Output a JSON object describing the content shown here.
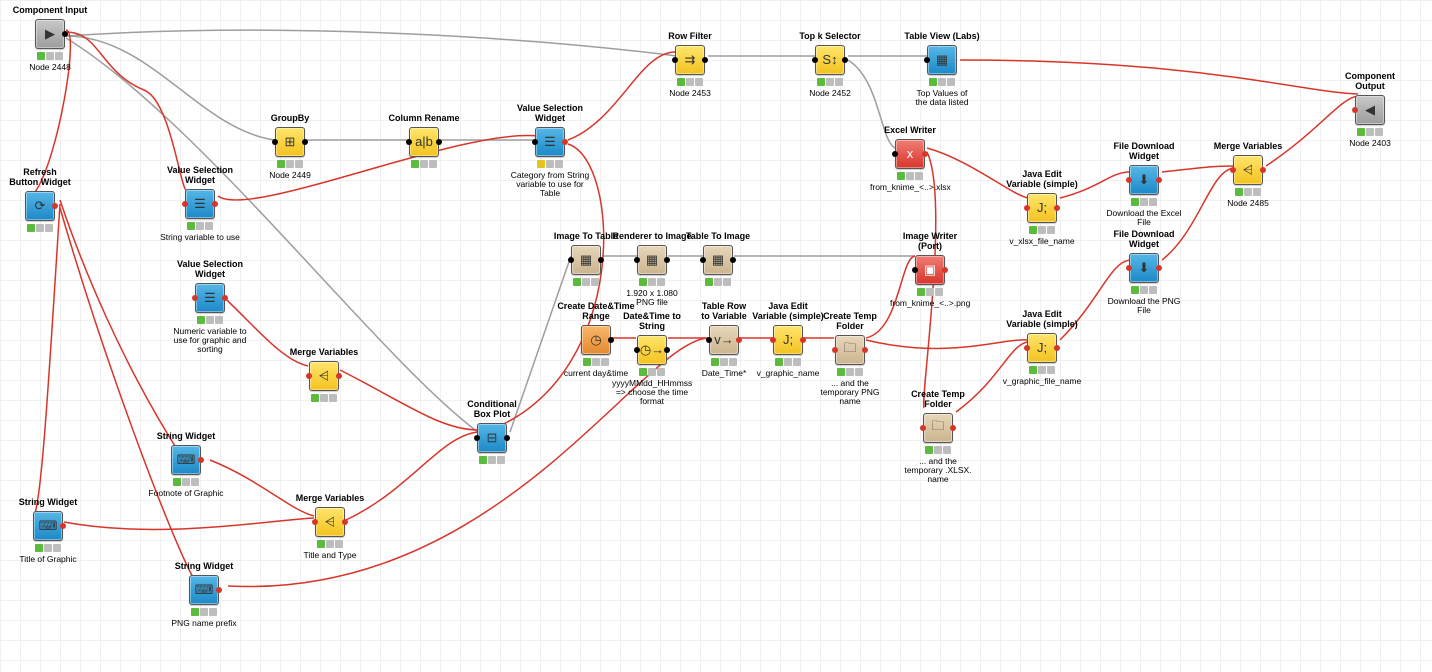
{
  "nodes": {
    "component_input": {
      "title": "Component Input",
      "sub": "Node 2448"
    },
    "refresh_button": {
      "title": "Refresh\nButton Widget",
      "sub": ""
    },
    "vs_widget_1": {
      "title": "Value Selection\nWidget",
      "sub": "String variable to use"
    },
    "vs_widget_2": {
      "title": "Value Selection\nWidget",
      "sub": "Numeric variable to use for graphic and sorting"
    },
    "vs_widget_main": {
      "title": "Value Selection\nWidget",
      "sub": "Category from String variable to use for Table"
    },
    "groupby": {
      "title": "GroupBy",
      "sub": "Node 2449"
    },
    "column_rename": {
      "title": "Column Rename",
      "sub": ""
    },
    "row_filter": {
      "title": "Row Filter",
      "sub": "Node 2453"
    },
    "topk": {
      "title": "Top k Selector",
      "sub": "Node 2452"
    },
    "table_view": {
      "title": "Table View (Labs)",
      "sub": "Top Values of\nthe data listed"
    },
    "excel_writer": {
      "title": "Excel Writer",
      "sub": "from_knime_<..>.xlsx"
    },
    "java_edit_xlsx": {
      "title": "Java Edit\nVariable (simple)",
      "sub": "v_xlsx_file_name"
    },
    "file_dl_excel": {
      "title": "File Download\nWidget",
      "sub": "Download the Excel File"
    },
    "merge_vars_r": {
      "title": "Merge Variables",
      "sub": "Node 2485"
    },
    "component_output": {
      "title": "Component Output",
      "sub": "Node 2403"
    },
    "image_to_table": {
      "title": "Image To Table",
      "sub": ""
    },
    "renderer_to_img": {
      "title": "Renderer to Image",
      "sub": "1.920 x 1.080\nPNG file"
    },
    "table_to_image": {
      "title": "Table To Image",
      "sub": ""
    },
    "image_writer": {
      "title": "Image Writer (Port)",
      "sub": "from_knime_<..>.png"
    },
    "file_dl_png": {
      "title": "File Download\nWidget",
      "sub": "Download the PNG File"
    },
    "java_edit_png": {
      "title": "Java Edit\nVariable (simple)",
      "sub": "v_graphic_file_name"
    },
    "create_dt_range": {
      "title": "Create Date&Time\nRange",
      "sub": "current day&time"
    },
    "dt_to_string": {
      "title": "Date&Time to String",
      "sub": "yyyyMMdd_HHmmss\n=> choose the time format"
    },
    "table_row_var": {
      "title": "Table Row\nto Variable",
      "sub": "Date_Time*"
    },
    "java_edit_gname": {
      "title": "Java Edit\nVariable (simple)",
      "sub": "v_graphic_name"
    },
    "create_temp_1": {
      "title": "Create Temp Folder",
      "sub": "... and the\ntemporary PNG name"
    },
    "create_temp_2": {
      "title": "Create Temp Folder",
      "sub": "... and the\ntemporary .XLSX. name"
    },
    "cond_box_plot": {
      "title": "Conditional\nBox Plot",
      "sub": ""
    },
    "merge_vars_l": {
      "title": "Merge Variables",
      "sub": ""
    },
    "merge_vars_tt": {
      "title": "Merge Variables",
      "sub": "Title and Type"
    },
    "string_foot": {
      "title": "String Widget",
      "sub": "Footnote of Graphic"
    },
    "string_title": {
      "title": "String Widget",
      "sub": "Title of Graphic"
    },
    "string_png": {
      "title": "String Widget",
      "sub": "PNG name prefix"
    }
  },
  "status_colors": {
    "green": "#5bbb3d",
    "yellow": "#e6c31f",
    "gray": "#bdbdbd"
  }
}
